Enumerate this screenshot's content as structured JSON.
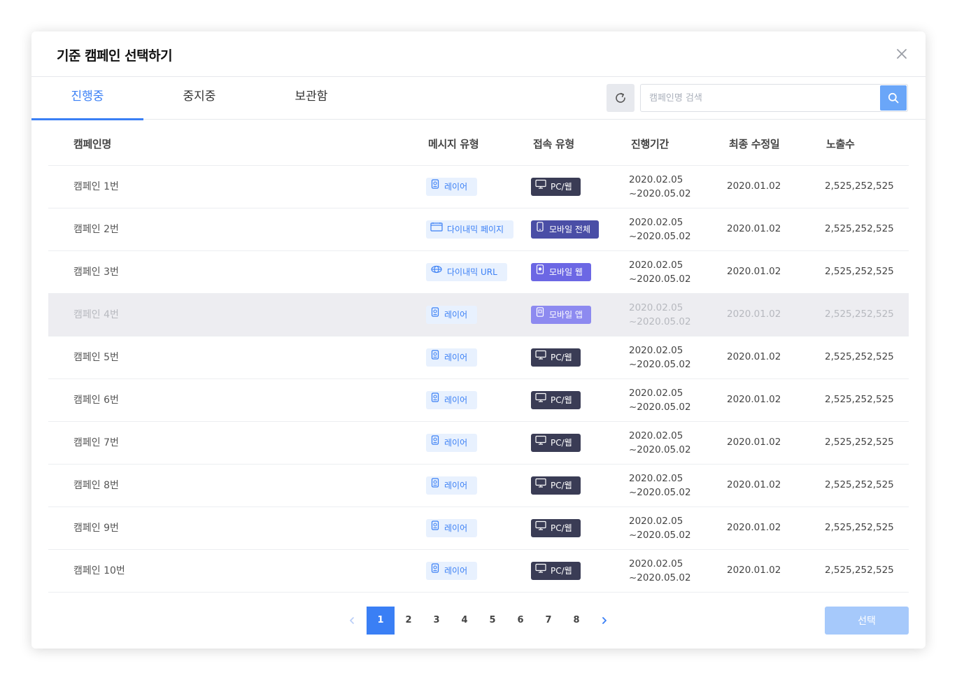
{
  "modal": {
    "title": "기준 캠페인 선택하기"
  },
  "tabs": [
    {
      "label": "진행중",
      "active": true
    },
    {
      "label": "중지중",
      "active": false
    },
    {
      "label": "보관함",
      "active": false
    }
  ],
  "search": {
    "placeholder": "캠페인명 검색",
    "value": ""
  },
  "table": {
    "headers": [
      "캠페인명",
      "메시지 유형",
      "접속 유형",
      "진행기간",
      "최종 수정일",
      "노출수"
    ],
    "rows": [
      {
        "name": "캠페인 1번",
        "message_type": "레이어",
        "message_icon": "layer-icon",
        "access_type": "PC/웹",
        "access_style": "pc",
        "period_start": "2020.02.05",
        "period_end": "~2020.05.02",
        "modified": "2020.01.02",
        "views": "2,525,252,525"
      },
      {
        "name": "캠페인 2번",
        "message_type": "다이내믹 페이지",
        "message_icon": "dynamic-page-icon",
        "access_type": "모바일 전체",
        "access_style": "mobile-all",
        "period_start": "2020.02.05",
        "period_end": "~2020.05.02",
        "modified": "2020.01.02",
        "views": "2,525,252,525"
      },
      {
        "name": "캠페인 3번",
        "message_type": "다이내믹 URL",
        "message_icon": "dynamic-url-icon",
        "access_type": "모바일 웹",
        "access_style": "mobile-web",
        "period_start": "2020.02.05",
        "period_end": "~2020.05.02",
        "modified": "2020.01.02",
        "views": "2,525,252,525"
      },
      {
        "name": "캠페인 4번",
        "message_type": "레이어",
        "message_icon": "layer-icon",
        "access_type": "모바일 앱",
        "access_style": "mobile-app",
        "period_start": "2020.02.05",
        "period_end": "~2020.05.02",
        "modified": "2020.01.02",
        "views": "2,525,252,525",
        "hovered": true
      },
      {
        "name": "캠페인 5번",
        "message_type": "레이어",
        "message_icon": "layer-icon",
        "access_type": "PC/웹",
        "access_style": "pc",
        "period_start": "2020.02.05",
        "period_end": "~2020.05.02",
        "modified": "2020.01.02",
        "views": "2,525,252,525"
      },
      {
        "name": "캠페인 6번",
        "message_type": "레이어",
        "message_icon": "layer-icon",
        "access_type": "PC/웹",
        "access_style": "pc",
        "period_start": "2020.02.05",
        "period_end": "~2020.05.02",
        "modified": "2020.01.02",
        "views": "2,525,252,525"
      },
      {
        "name": "캠페인 7번",
        "message_type": "레이어",
        "message_icon": "layer-icon",
        "access_type": "PC/웹",
        "access_style": "pc",
        "period_start": "2020.02.05",
        "period_end": "~2020.05.02",
        "modified": "2020.01.02",
        "views": "2,525,252,525"
      },
      {
        "name": "캠페인 8번",
        "message_type": "레이어",
        "message_icon": "layer-icon",
        "access_type": "PC/웹",
        "access_style": "pc",
        "period_start": "2020.02.05",
        "period_end": "~2020.05.02",
        "modified": "2020.01.02",
        "views": "2,525,252,525"
      },
      {
        "name": "캠페인 9번",
        "message_type": "레이어",
        "message_icon": "layer-icon",
        "access_type": "PC/웹",
        "access_style": "pc",
        "period_start": "2020.02.05",
        "period_end": "~2020.05.02",
        "modified": "2020.01.02",
        "views": "2,525,252,525"
      },
      {
        "name": "캠페인 10번",
        "message_type": "레이어",
        "message_icon": "layer-icon",
        "access_type": "PC/웹",
        "access_style": "pc",
        "period_start": "2020.02.05",
        "period_end": "~2020.05.02",
        "modified": "2020.01.02",
        "views": "2,525,252,525"
      }
    ]
  },
  "pagination": {
    "pages": [
      "1",
      "2",
      "3",
      "4",
      "5",
      "6",
      "7",
      "8"
    ],
    "current": "1"
  },
  "footer": {
    "select_label": "선택"
  },
  "colors": {
    "accent": "#3a7ff5",
    "pc_badge": "#3a3c55",
    "mobile_all_badge": "#4a4ea6",
    "mobile_web_badge": "#6c67e4",
    "mobile_app_badge": "#8d8af0",
    "select_button_disabled": "#a6c9fb"
  }
}
